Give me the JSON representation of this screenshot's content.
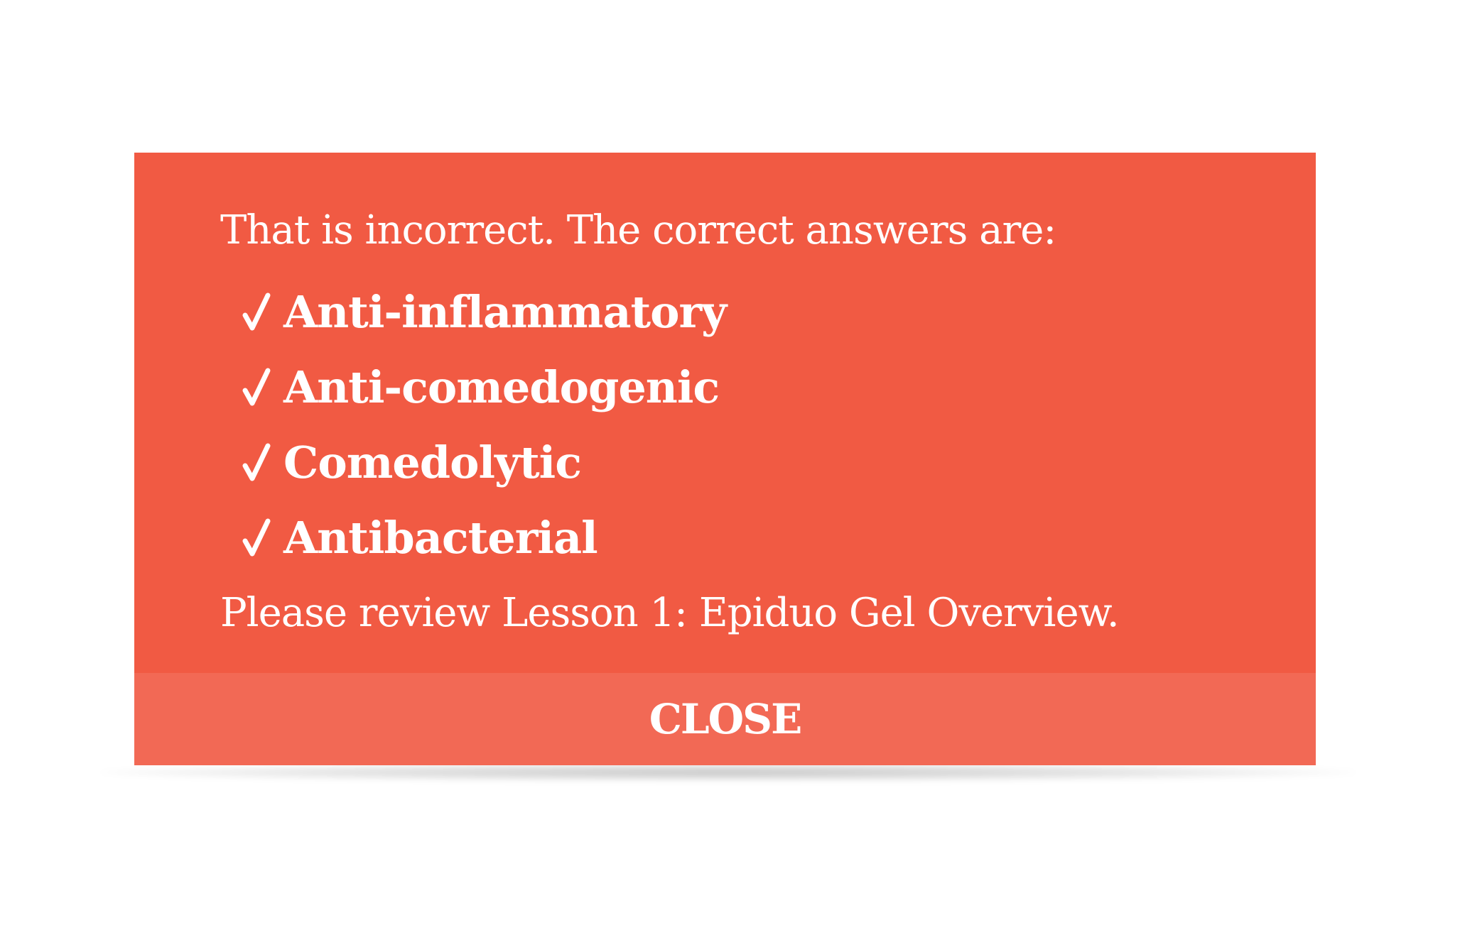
{
  "dialog": {
    "intro_text": "That is incorrect. The correct answers are:",
    "answers": [
      {
        "icon": "check-icon",
        "label": "Anti-inflammatory"
      },
      {
        "icon": "check-icon",
        "label": "Anti-comedogenic"
      },
      {
        "icon": "check-icon",
        "label": "Comedolytic"
      },
      {
        "icon": "check-icon",
        "label": "Antibacterial"
      }
    ],
    "review_text": "Please review Lesson 1: Epiduo Gel Overview.",
    "close_label": "CLOSE"
  },
  "colors": {
    "dialog_background": "#f15a43",
    "close_bar_background": "#f26955",
    "text": "#ffffff",
    "page_background": "#ffffff"
  }
}
